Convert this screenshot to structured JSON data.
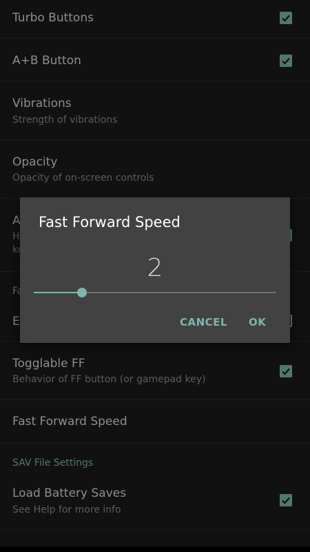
{
  "settings": {
    "turbo_buttons": {
      "title": "Turbo Buttons",
      "checked": true
    },
    "ab_button": {
      "title": "A+B Button",
      "checked": true
    },
    "vibrations": {
      "title": "Vibrations",
      "summary": "Strength of vibrations"
    },
    "opacity": {
      "title": "Opacity",
      "summary": "Opacity of on-screen controls"
    },
    "hidden_item": {
      "title_fragment": "A",
      "summary_fragment_1": "H",
      "summary_fragment_2": "ke"
    },
    "hidden_category": {
      "label_fragment": "Fa"
    },
    "hidden_item2": {
      "title_fragment": "E"
    },
    "togglable_ff": {
      "title": "Togglable FF",
      "summary": "Behavior of FF button (or gamepad key)",
      "checked": true
    },
    "ff_speed": {
      "title": "Fast Forward Speed"
    },
    "sav_category": {
      "label": "SAV File Settings"
    },
    "load_battery": {
      "title": "Load Battery Saves",
      "summary": "See Help for more info",
      "checked": true
    }
  },
  "dialog": {
    "title": "Fast Forward Speed",
    "value": "2",
    "slider_fraction": 0.2,
    "cancel_label": "CANCEL",
    "ok_label": "OK"
  },
  "colors": {
    "accent": "#7fb5ad",
    "background": "#1b1b1b",
    "dialog": "#424242"
  }
}
